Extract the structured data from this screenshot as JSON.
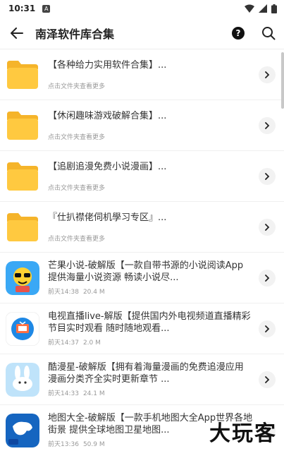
{
  "status": {
    "time": "10:31",
    "badge": "A"
  },
  "header": {
    "title": "南泽软件库合集"
  },
  "folders": [
    {
      "name": "【各种给力实用软件合集】...",
      "hint": "点击文件夹查看更多"
    },
    {
      "name": "【休闲趣味游戏破解合集】...",
      "hint": "点击文件夹查看更多"
    },
    {
      "name": "【追剧追漫免费小说漫画】...",
      "hint": "点击文件夹查看更多"
    },
    {
      "name": "『仕扒襟佬伺机學习专区』...",
      "hint": "点击文件夹查看更多"
    }
  ],
  "apps": [
    {
      "name": "芒果小说-破解版【一款自带书源的小说阅读App 提供海量小说资源 畅读小说尽...",
      "date": "前天14:38",
      "size": "20.4 M"
    },
    {
      "name": "电视直播live-解版【提供国内外电视频道直播精彩节目实时观看 随时随地观看...",
      "date": "前天14:37",
      "size": "2.0 M"
    },
    {
      "name": "酷漫星-破解版【拥有着海量漫画的免费追漫应用 漫画分类齐全实时更新章节 ...",
      "date": "前天14:33",
      "size": "24.1 M"
    },
    {
      "name": "地图大全-破解版【一款手机地图大全App世界各地街景 提供全球地图卫星地图...",
      "date": "前天13:36",
      "size": "50.9 M"
    }
  ],
  "watermark": "大玩客",
  "colors": {
    "folder": "#FFC940",
    "folder_back": "#F5B42A",
    "chevron_bg": "#f2f2f2"
  }
}
